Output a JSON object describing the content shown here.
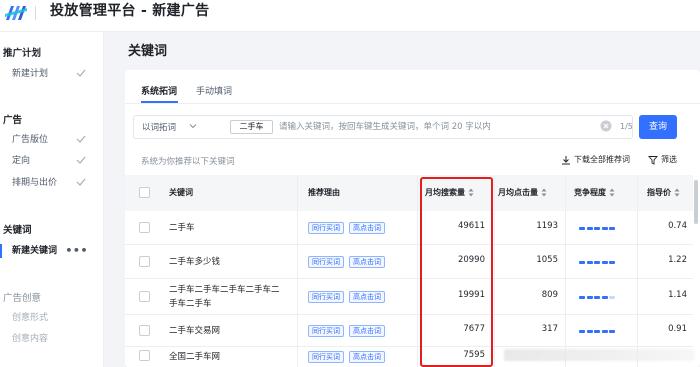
{
  "app": {
    "title": "投放管理平台 - 新建广告"
  },
  "sidebar": {
    "sections": [
      {
        "title": "推广计划",
        "items": [
          {
            "label": "新建计划",
            "done": true
          }
        ]
      },
      {
        "title": "广告",
        "items": [
          {
            "label": "广告版位",
            "done": true
          },
          {
            "label": "定向",
            "done": true
          },
          {
            "label": "排期与出价",
            "done": true
          }
        ]
      },
      {
        "title": "关键词",
        "items": [
          {
            "label": "新建关键词",
            "active": true,
            "more": "•••"
          }
        ]
      },
      {
        "title": "广告创意",
        "items": [
          {
            "label": "创意形式"
          },
          {
            "label": "创意内容"
          }
        ]
      }
    ]
  },
  "page": {
    "title": "关键词"
  },
  "tabs": [
    {
      "label": "系统拓词",
      "active": true
    },
    {
      "label": "手动填词",
      "active": false
    }
  ],
  "search": {
    "mode": "以词拓词",
    "chip": "二手车",
    "placeholder": "请输入关键词，按回车键生成关键词，单个词 20 字以内",
    "value": "",
    "counter": "1/5",
    "button": "查询"
  },
  "recommend_text": "系统为你推荐以下关键词",
  "actions": {
    "download": "下载全部推荐词",
    "filter": "筛选"
  },
  "table": {
    "columns": [
      "关键词",
      "推荐理由",
      "月均搜索量",
      "月均点击量",
      "竞争程度",
      "指导价"
    ],
    "rows": [
      {
        "keyword": "二手车",
        "reasons": [
          "同行买词",
          "高点击词"
        ],
        "searches": "49611",
        "clicks": "1193",
        "competition": 5,
        "price": "0.74"
      },
      {
        "keyword": "二手车多少钱",
        "reasons": [
          "同行买词",
          "高点击词"
        ],
        "searches": "20990",
        "clicks": "1055",
        "competition": 5,
        "price": "1.22"
      },
      {
        "keyword": "二手车二手车二手车二手车二手车二手车",
        "reasons": [
          "同行买词",
          "高点击词"
        ],
        "searches": "19991",
        "clicks": "809",
        "competition": 4,
        "price": "1.14"
      },
      {
        "keyword": "二手车交易网",
        "reasons": [
          "同行买词",
          "高点击词"
        ],
        "searches": "7677",
        "clicks": "317",
        "competition": 5,
        "price": "0.91"
      },
      {
        "keyword": "全国二手车网",
        "reasons": [
          "同行买词",
          "高点击词"
        ],
        "searches": "7595",
        "clicks": "",
        "competition": 0,
        "price": ""
      }
    ]
  },
  "colors": {
    "primary": "#3370ff",
    "highlight": "#e02020"
  }
}
